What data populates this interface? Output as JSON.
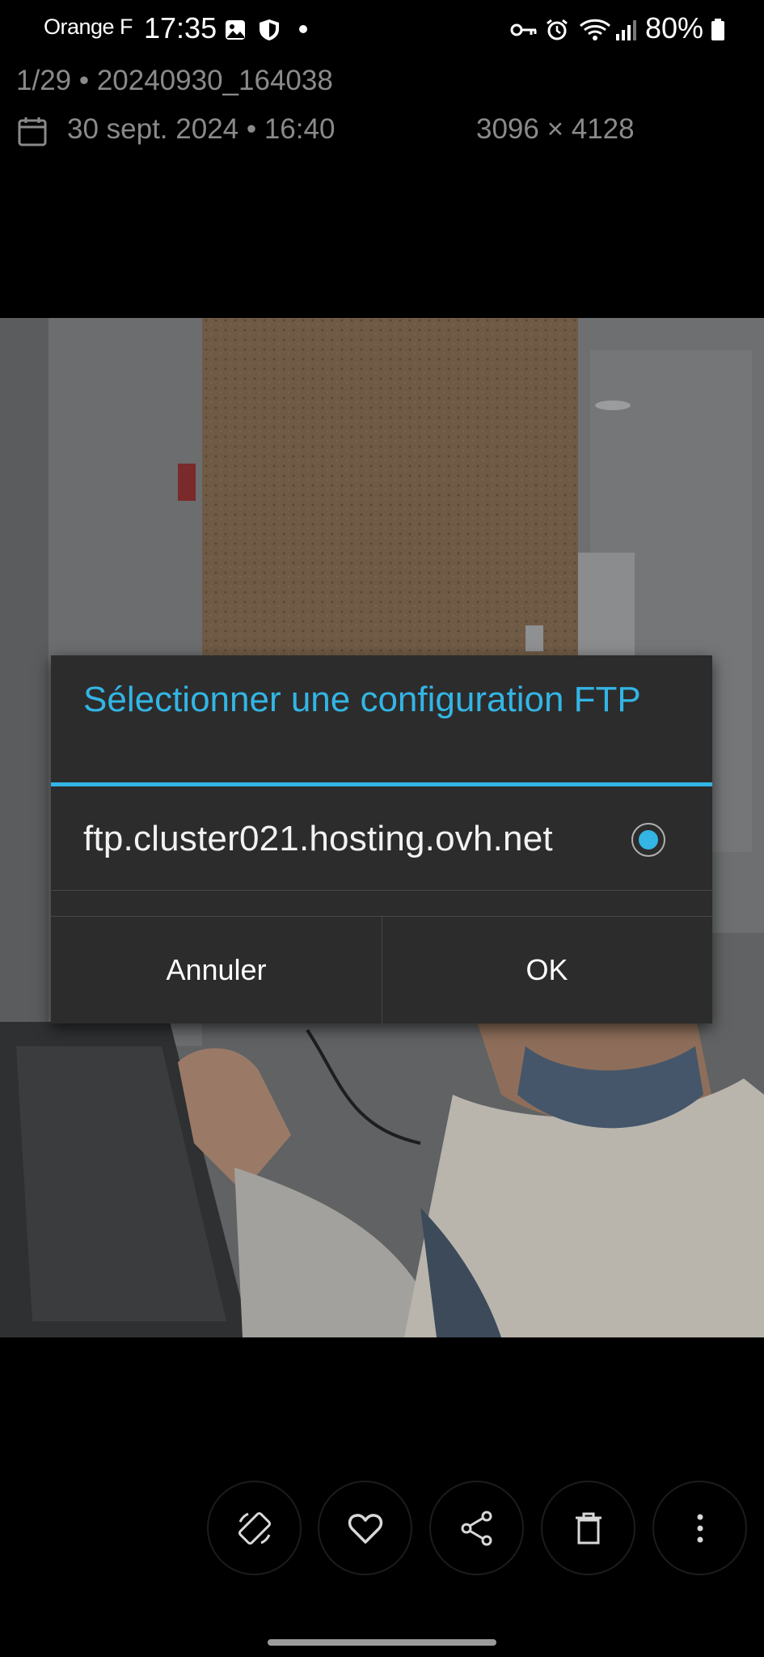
{
  "status_bar": {
    "carrier": "Orange F",
    "time": "17:35",
    "battery": "80%",
    "icons": [
      "gallery-icon",
      "shield-icon",
      "key-icon",
      "alarm-icon",
      "wifi-icon",
      "signal-icon",
      "battery-icon"
    ]
  },
  "info": {
    "counter_and_name": "1/29 • 20240930_164038",
    "date": "30 sept. 2024 • 16:40",
    "dimensions": "3096 × 4128"
  },
  "dialog": {
    "title": "Sélectionner une configuration FTP",
    "option": "ftp.cluster021.hosting.ovh.net",
    "option_selected": true,
    "cancel_label": "Annuler",
    "ok_label": "OK",
    "accent_color": "#33b5e5"
  },
  "toolbar": {
    "icons": [
      "rotate-icon",
      "favorite-icon",
      "share-icon",
      "delete-icon",
      "more-icon"
    ]
  }
}
